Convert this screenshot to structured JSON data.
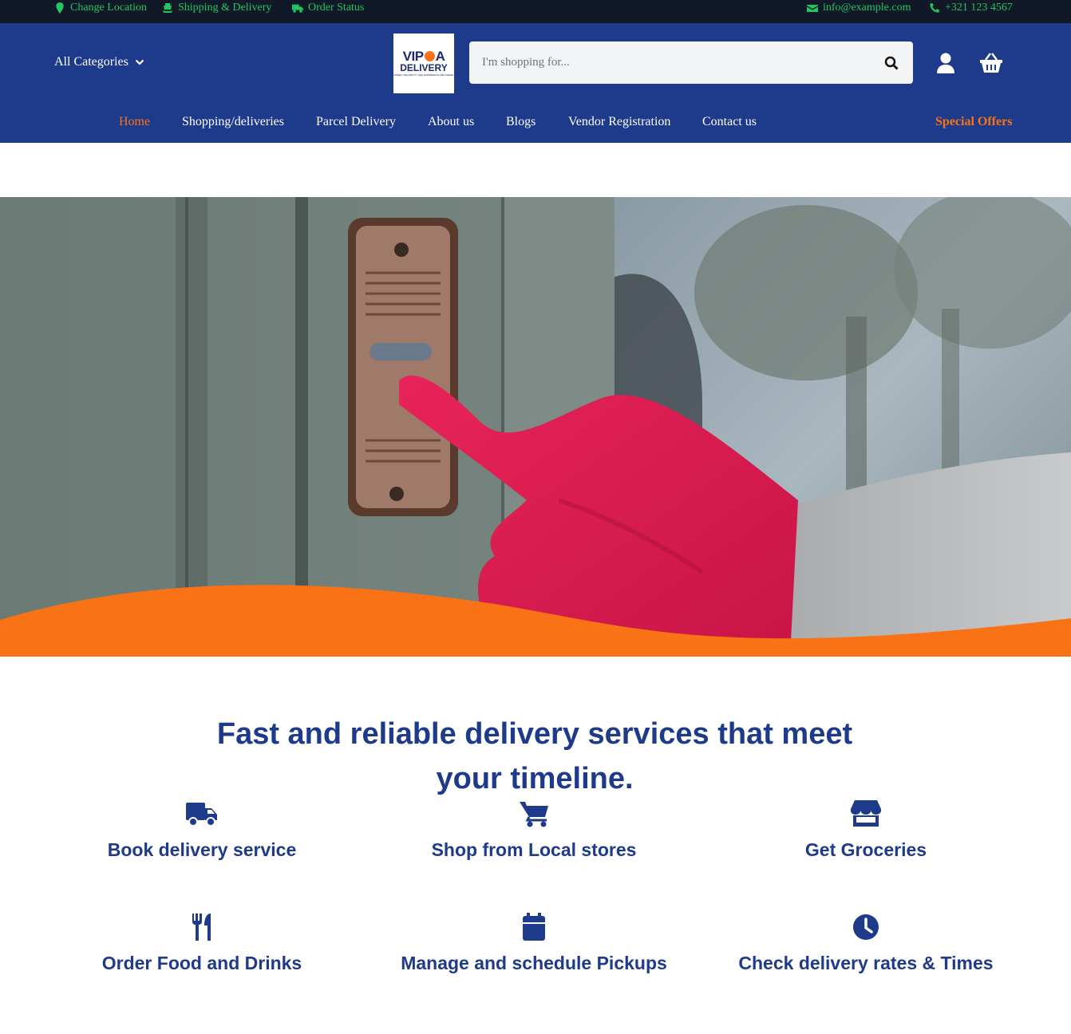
{
  "topbar": {
    "change_location": "Change Location",
    "shipping": "Shipping & Delivery",
    "order_status": "Order Status",
    "email": "info@example.com",
    "phone": "+321 123 4567"
  },
  "header": {
    "categories_label": "All Categories",
    "logo_line1a": "VIP",
    "logo_line1b": "A",
    "logo_line2": "DELIVERY",
    "logo_tagline": "SPEED, RELIABILITY AND EXPERIENCE DELIVERED",
    "search_placeholder": "I'm shopping for..."
  },
  "nav": {
    "items": [
      "Home",
      "Shopping/deliveries",
      "Parcel Delivery",
      "About us",
      "Blogs",
      "Vendor Registration",
      "Contact us"
    ],
    "special": "Special Offers"
  },
  "main": {
    "headline_line1": "Fast and reliable delivery services that meet",
    "headline_line2": "your timeline.",
    "services": [
      {
        "label": "Book delivery service",
        "icon": "truck-icon"
      },
      {
        "label": "Shop from Local stores",
        "icon": "cart-icon"
      },
      {
        "label": "Get Groceries",
        "icon": "store-icon"
      },
      {
        "label": "Order Food and Drinks",
        "icon": "utensils-icon"
      },
      {
        "label": "Manage and schedule Pickups",
        "icon": "calendar-icon"
      },
      {
        "label": "Check delivery rates & Times",
        "icon": "clock-icon"
      }
    ]
  },
  "colors": {
    "topbar_bg": "#111827",
    "topbar_text": "#22c55e",
    "header_bg": "#1e3a8a",
    "accent": "#f97316",
    "heading": "#1e3a8a"
  }
}
